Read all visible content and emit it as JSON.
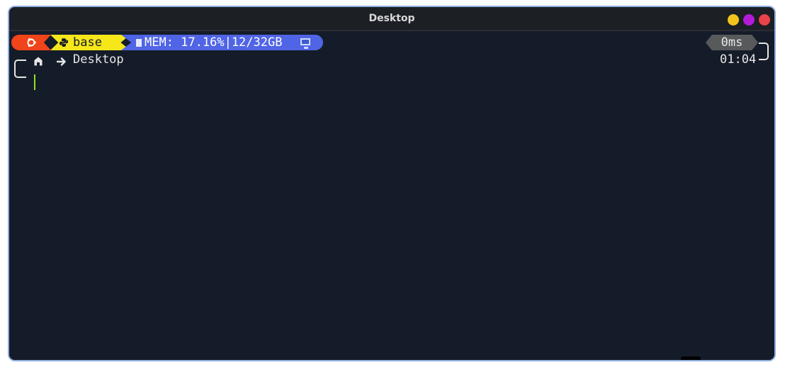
{
  "window": {
    "title": "Desktop",
    "buttons": [
      "minimize",
      "maximize",
      "close"
    ],
    "colors": {
      "minimize": "#f2c31c",
      "maximize": "#b31bd8",
      "close": "#e8424a",
      "border": "#8fb0e0",
      "terminal_background": "#151c29"
    }
  },
  "prompt": {
    "os_segment": {
      "icon": "ubuntu-icon",
      "color": "#f0441a"
    },
    "env_segment": {
      "icon": "python-icon",
      "label": "base",
      "color": "#f5e71a"
    },
    "memory_segment": {
      "icon": "memory-chip-icon",
      "label": "MEM: 17.16%|12/32GB",
      "trailing_icon": "monitor-icon",
      "color": "#5064e6"
    },
    "duration_segment": {
      "label": "0ms",
      "color": "#58595b"
    },
    "time": "01:04",
    "path": {
      "home_icon": "home-icon",
      "separator_icon": "arrow-right-icon",
      "label": "Desktop"
    },
    "cursor_color": "#8fe31a"
  }
}
